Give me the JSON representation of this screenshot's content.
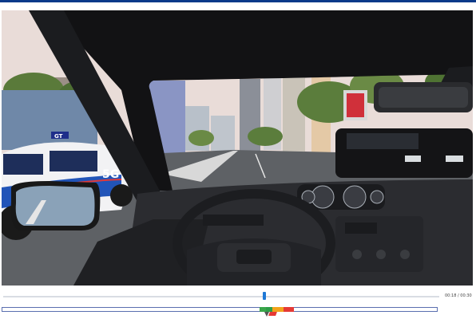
{
  "player": {
    "time_display": "00:18 / 00:30",
    "progress_fraction": 0.6
  },
  "colors": {
    "accent_bar": "#0b3a8a",
    "seek_handle": "#1e78d6",
    "timeline_border": "#5a6fb0",
    "event_green": "#3aa64a",
    "event_orange": "#f2a31b",
    "event_red": "#e53935"
  },
  "scene": {
    "police_car_roof_text": "GT",
    "police_car_door_text": "5G"
  },
  "timeline": {
    "segments": [
      {
        "name": "event-segment-green",
        "color": "#3aa64a"
      },
      {
        "name": "event-segment-green-2",
        "color": "#2e9e47"
      },
      {
        "name": "event-segment-orange",
        "color": "#f2a31b"
      },
      {
        "name": "event-segment-red",
        "color": "#e53935"
      }
    ]
  }
}
